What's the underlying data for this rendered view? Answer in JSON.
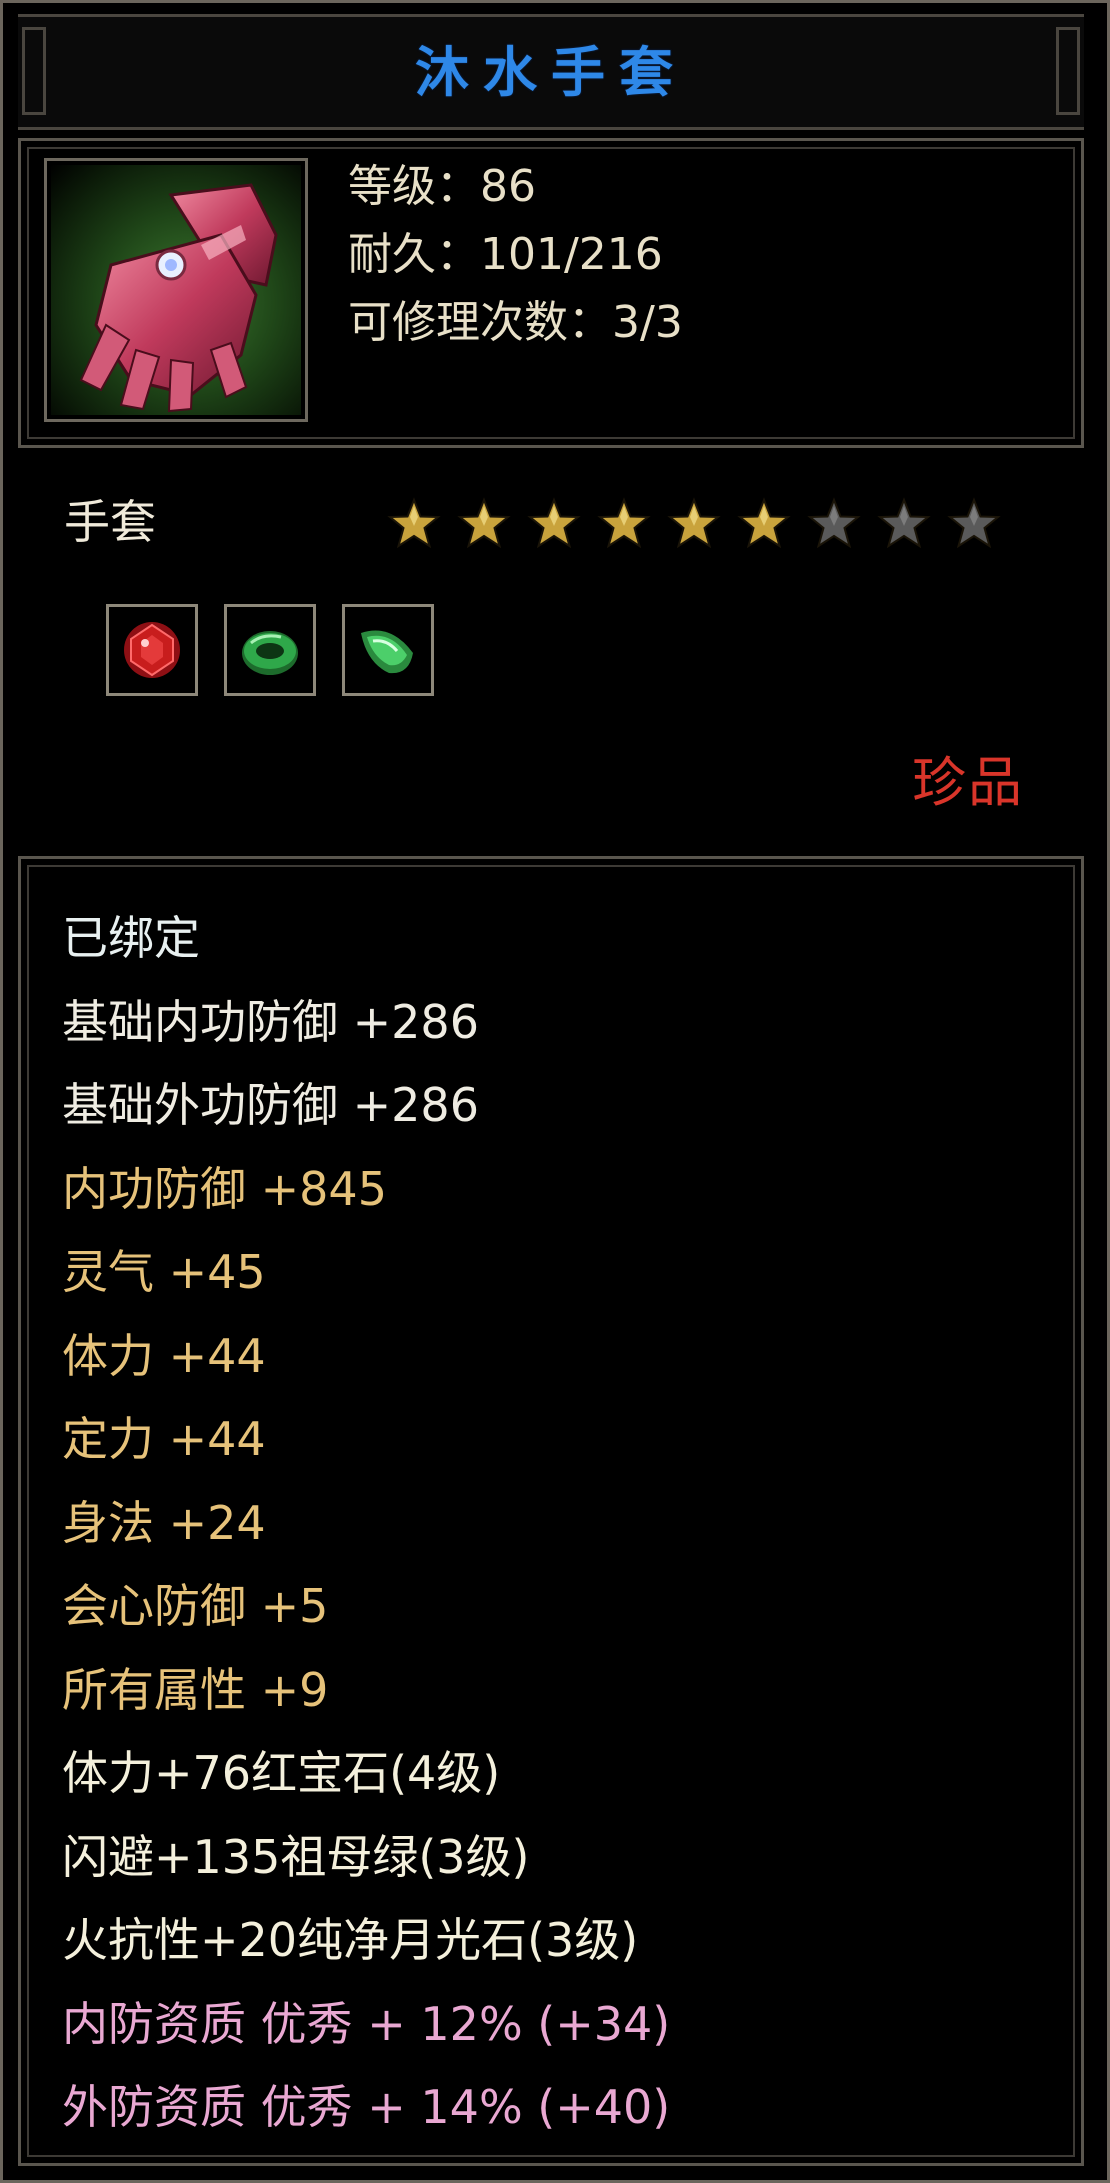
{
  "title": "沐水手套",
  "info": {
    "level": "等级：86",
    "durability": "耐久：101/216",
    "repair": "可修理次数：3/3"
  },
  "item": {
    "icon": "gauntlet-icon",
    "type": "手套",
    "stars_total": 9,
    "stars_filled": 6,
    "rarity": "珍品",
    "gems": [
      {
        "icon": "ruby-gem-icon",
        "color": "#c81d1d"
      },
      {
        "icon": "emerald-ring-gem-icon",
        "color": "#2fa84a"
      },
      {
        "icon": "moonstone-gem-icon",
        "color": "#4ccf6a"
      }
    ]
  },
  "colors": {
    "title": "#2e88e8",
    "base_attr": "#efece2",
    "bonus_attr": "#e6c27a",
    "gem_attr": "#f4f0dc",
    "quality_attr": "#e9a8d2",
    "rarity": "#d9352a",
    "star_filled": "#c9a33c",
    "star_empty": "#5a5a5a"
  },
  "attributes": [
    {
      "text": "已绑定",
      "kind": "bound"
    },
    {
      "text": "基础内功防御  +286",
      "kind": "white"
    },
    {
      "text": "基础外功防御  +286",
      "kind": "white"
    },
    {
      "text": "内功防御  +845",
      "kind": "gold"
    },
    {
      "text": "灵气  +45",
      "kind": "gold"
    },
    {
      "text": "体力  +44",
      "kind": "gold"
    },
    {
      "text": "定力  +44",
      "kind": "gold"
    },
    {
      "text": "身法  +24",
      "kind": "gold"
    },
    {
      "text": "会心防御  +5",
      "kind": "gold"
    },
    {
      "text": "所有属性  +9",
      "kind": "gold"
    },
    {
      "text": "体力+76红宝石(4级)",
      "kind": "gem"
    },
    {
      "text": "闪避+135祖母绿(3级)",
      "kind": "gem"
    },
    {
      "text": "火抗性+20纯净月光石(3级)",
      "kind": "gem"
    },
    {
      "text": "内防资质  优秀  + 12% (+34)",
      "kind": "pink"
    },
    {
      "text": "外防资质  优秀  + 14% (+40)",
      "kind": "pink"
    }
  ]
}
